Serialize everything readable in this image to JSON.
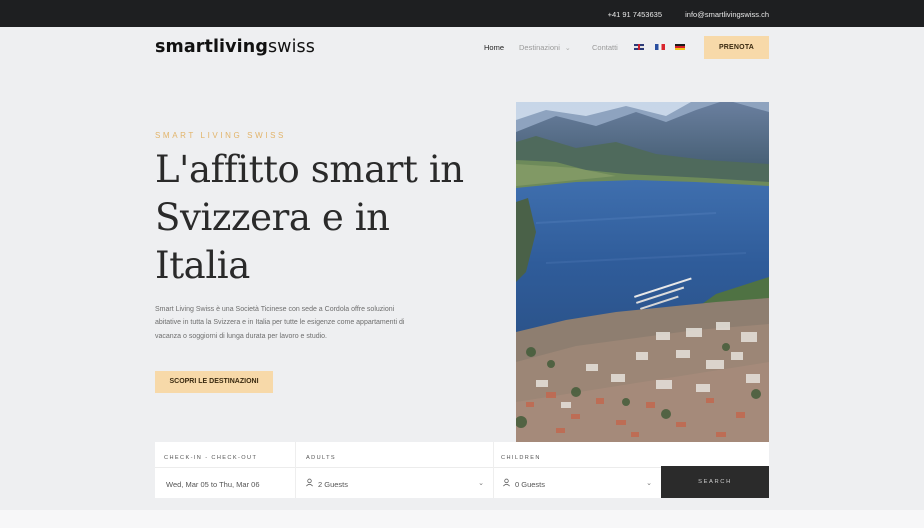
{
  "topbar": {
    "phone": "+41 91 7453635",
    "email": "info@smartlivingswiss.ch"
  },
  "header": {
    "logo_bold": "smartliving",
    "logo_light": "swiss",
    "nav": {
      "home": "Home",
      "destinations": "Destinazioni",
      "contacts": "Contatti"
    },
    "book_label": "PRENOTA"
  },
  "hero": {
    "eyebrow": "SMART LIVING SWISS",
    "title": "L'affitto smart in Svizzera e in Italia",
    "description": "Smart Living Swiss è una Società Ticinese con sede a Cordola offre soluzioni abitative in tutta la Svizzera e in Italia per tutte le esigenze come appartamenti di vacanza o soggiorni di lunga durata per lavoro e studio.",
    "cta_label": "SCOPRI LE DESTINAZIONI"
  },
  "booking": {
    "dates_label": "CHECK-IN - CHECK-OUT",
    "dates_value": "Wed, Mar 05 to Thu, Mar 06",
    "adults_label": "ADULTS",
    "adults_value": "2 Guests",
    "children_label": "CHILDREN",
    "children_value": "0 Guests",
    "search_label": "SEARCH"
  },
  "colors": {
    "accent": "#f7d9a9",
    "eyebrow": "#e2b46a",
    "topbar": "#1e1f21",
    "search_button": "#2b2b2b"
  }
}
